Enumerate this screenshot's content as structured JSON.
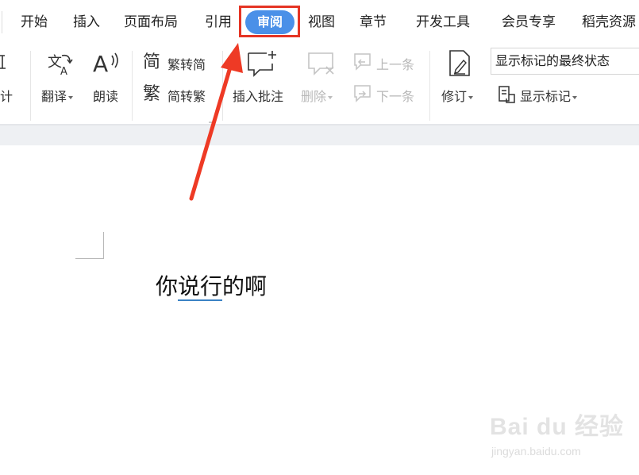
{
  "menu": {
    "items": [
      "开始",
      "插入",
      "页面布局",
      "引用",
      "审阅",
      "视图",
      "章节",
      "开发工具",
      "会员专享",
      "稻壳资源"
    ],
    "active": "审阅"
  },
  "toolbar": {
    "stats_partial": "计",
    "translate": "翻译",
    "read_aloud": "朗读",
    "trad_to_simp": "繁转简",
    "simp_to_trad": "简转繁",
    "insert_comment": "插入批注",
    "delete": "删除",
    "prev": "上一条",
    "next": "下一条",
    "revise": "修订",
    "show_markup_state": "显示标记的最终状态",
    "show_markup": "显示标记"
  },
  "document": {
    "text_before": "你",
    "text_underlined": "说行",
    "text_after": "的啊"
  },
  "watermark": {
    "logo": "Bai du 经验",
    "url": "jingyan.baidu.com"
  },
  "colors": {
    "active_tab": "#4a90e8",
    "highlight": "#e53424",
    "underline": "#3b82c4"
  }
}
